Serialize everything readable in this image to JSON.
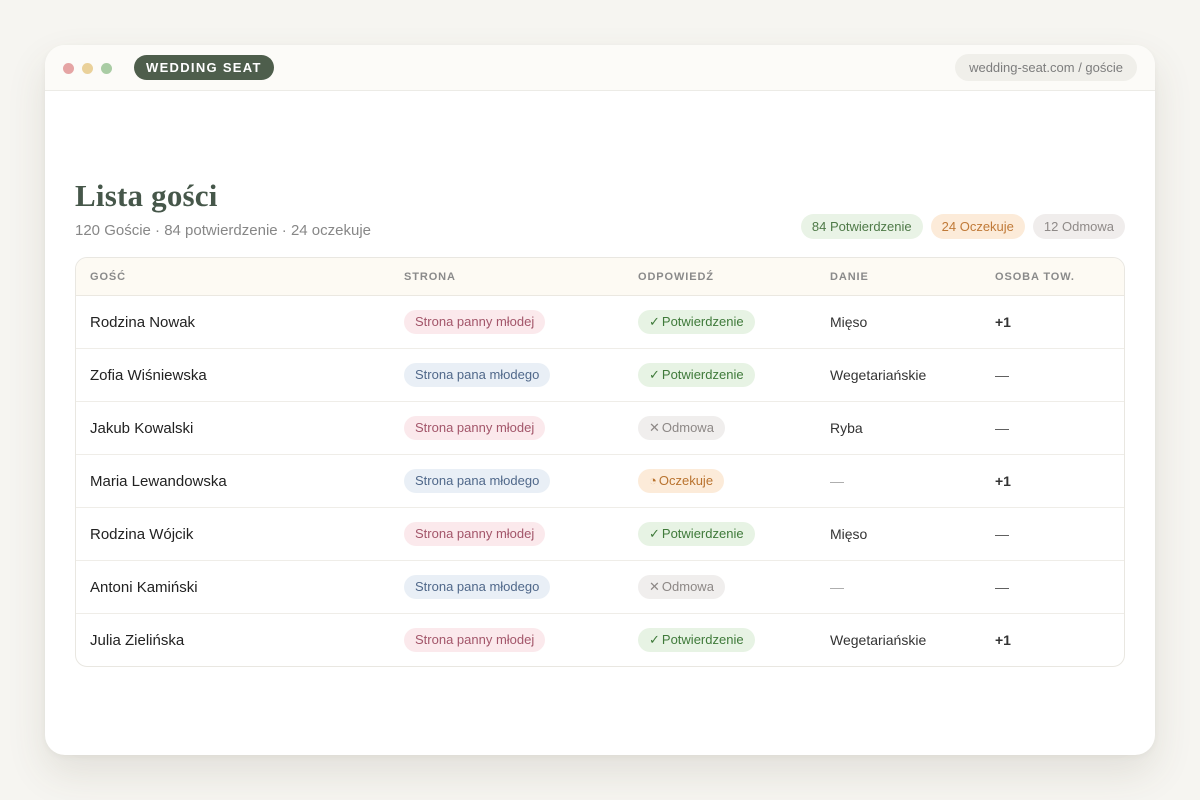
{
  "window": {
    "brand": "WEDDING SEAT",
    "url": "wedding-seat.com / goście"
  },
  "page": {
    "title": "Lista gości",
    "subtitle": "120 Goście · 84 potwierdzenie · 24 oczekuje"
  },
  "summary": {
    "confirmed": "84 Potwierdzenie",
    "pending": "24 Oczekuje",
    "declined": "12 Odmowa"
  },
  "table": {
    "columns": [
      "GOŚĆ",
      "STRONA",
      "ODPOWIEDŹ",
      "DANIE",
      "OSOBA TOW."
    ],
    "rows": [
      {
        "guest": "Rodzina Nowak",
        "side": "Strona panny młodej",
        "side_kind": "bride",
        "rsvp": "Potwierdzenie",
        "rsvp_kind": "confirmed",
        "rsvp_icon": "✓",
        "meal": "Mięso",
        "plus_one": "+1"
      },
      {
        "guest": "Zofia Wiśniewska",
        "side": "Strona pana młodego",
        "side_kind": "groom",
        "rsvp": "Potwierdzenie",
        "rsvp_kind": "confirmed",
        "rsvp_icon": "✓",
        "meal": "Wegetariańskie",
        "plus_one": "—"
      },
      {
        "guest": "Jakub Kowalski",
        "side": "Strona panny młodej",
        "side_kind": "bride",
        "rsvp": "Odmowa",
        "rsvp_kind": "declined",
        "rsvp_icon": "✕",
        "meal": "Ryba",
        "plus_one": "—"
      },
      {
        "guest": "Maria Lewandowska",
        "side": "Strona pana młodego",
        "side_kind": "groom",
        "rsvp": "Oczekuje",
        "rsvp_kind": "pending",
        "rsvp_icon": "◔",
        "meal": "—",
        "plus_one": "+1"
      },
      {
        "guest": "Rodzina Wójcik",
        "side": "Strona panny młodej",
        "side_kind": "bride",
        "rsvp": "Potwierdzenie",
        "rsvp_kind": "confirmed",
        "rsvp_icon": "✓",
        "meal": "Mięso",
        "plus_one": "—"
      },
      {
        "guest": "Antoni Kamiński",
        "side": "Strona pana młodego",
        "side_kind": "groom",
        "rsvp": "Odmowa",
        "rsvp_kind": "declined",
        "rsvp_icon": "✕",
        "meal": "—",
        "plus_one": "—"
      },
      {
        "guest": "Julia Zielińska",
        "side": "Strona panny młodej",
        "side_kind": "bride",
        "rsvp": "Potwierdzenie",
        "rsvp_kind": "confirmed",
        "rsvp_icon": "✓",
        "meal": "Wegetariańskie",
        "plus_one": "+1"
      }
    ]
  },
  "colors": {
    "brand": "#4e5e4c",
    "title": "#46574a",
    "confirmed": "#3f7a3a",
    "pending": "#b9732f",
    "declined": "#8d8886",
    "bride_side": "#a3566a",
    "groom_side": "#50688a"
  }
}
